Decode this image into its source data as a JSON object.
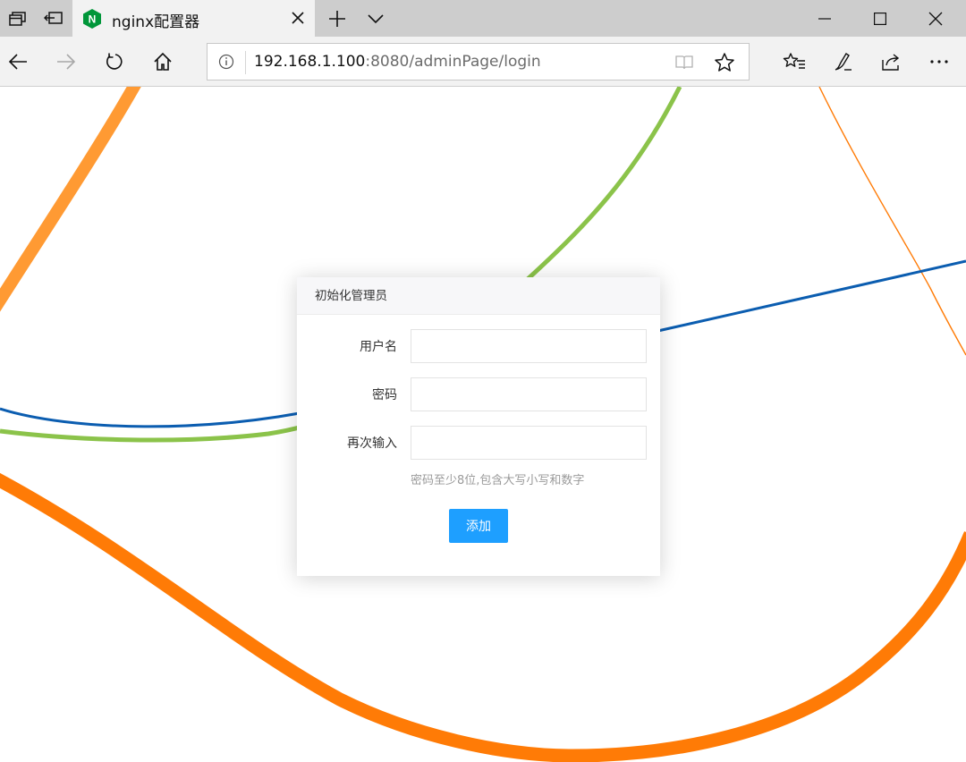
{
  "browser": {
    "tab": {
      "title": "nginx配置器",
      "logo_letter": "N"
    },
    "address": {
      "host": "192.168.1.100",
      "rest": ":8080/adminPage/login"
    }
  },
  "form": {
    "header": "初始化管理员",
    "fields": [
      {
        "label": "用户名",
        "value": ""
      },
      {
        "label": "密码",
        "value": ""
      },
      {
        "label": "再次输入",
        "value": ""
      }
    ],
    "hint": "密码至少8位,包含大写小写和数字",
    "submit_label": "添加"
  },
  "colors": {
    "accent": "#1e9fff",
    "line_orange": "#ff7b06",
    "line_orange_light": "#ff9a33",
    "line_green": "#8bc34a",
    "line_blue": "#0b5db0"
  },
  "icons": [
    "tab-preview-icon",
    "set-aside-tabs-icon",
    "nginx-logo",
    "close-icon",
    "new-tab-icon",
    "tab-list-chevron-icon",
    "minimize-icon",
    "maximize-icon",
    "window-close-icon",
    "back-icon",
    "forward-icon",
    "refresh-icon",
    "home-icon",
    "info-icon",
    "reading-view-icon",
    "favorite-star-icon",
    "favorites-list-icon",
    "pen-icon",
    "share-icon",
    "more-icon"
  ]
}
